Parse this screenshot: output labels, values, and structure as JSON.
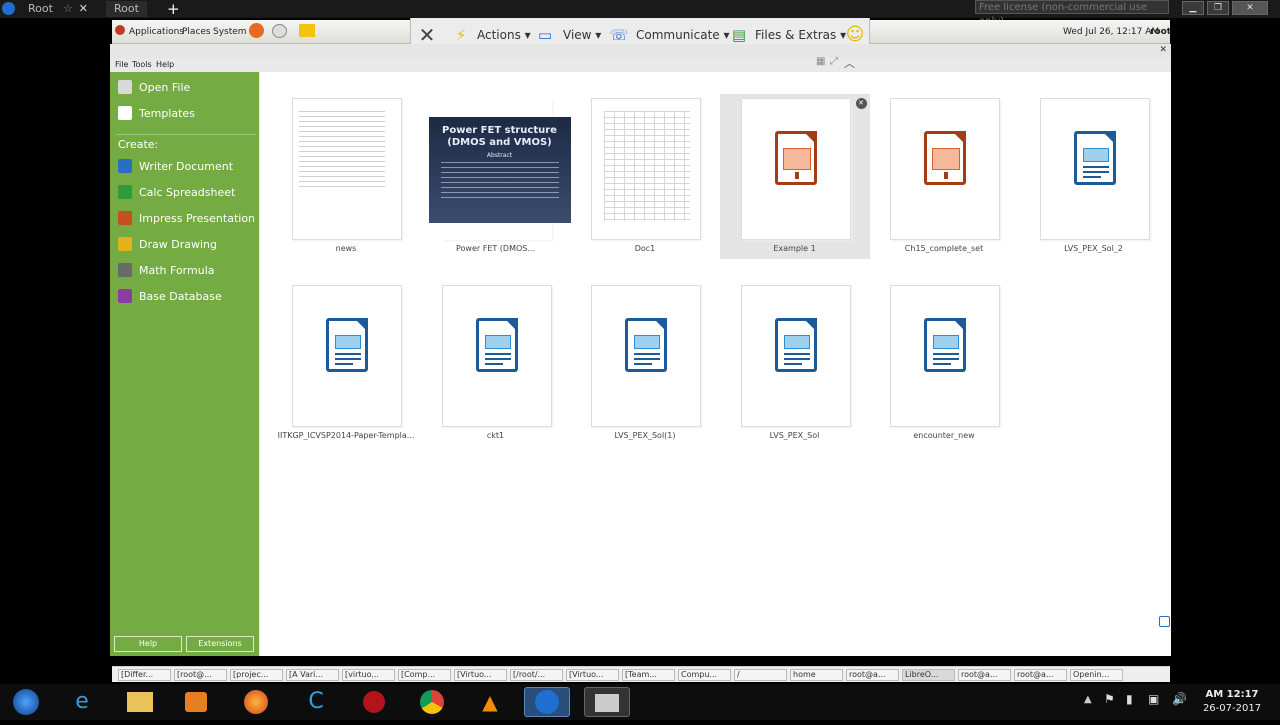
{
  "topbar": {
    "tabs": [
      {
        "label": "Root"
      },
      {
        "label": "Root"
      }
    ],
    "license": "Free license (non-commercial use only)"
  },
  "gnome_panel": {
    "applications": "Applications",
    "places": "Places",
    "system": "System",
    "datetime": "Wed Jul 26, 12:17 AM",
    "user": "root"
  },
  "tv_toolbar": {
    "actions": "Actions",
    "view": "View",
    "communicate": "Communicate",
    "files": "Files & Extras"
  },
  "lo_menu": {
    "file": "File",
    "tools": "Tools",
    "help": "Help"
  },
  "sidebar": {
    "open_file": "Open File",
    "templates": "Templates",
    "create_label": "Create:",
    "items": [
      {
        "label": "Writer Document",
        "color": "#2a6fbf"
      },
      {
        "label": "Calc Spreadsheet",
        "color": "#2f9b3a"
      },
      {
        "label": "Impress Presentation",
        "color": "#c4501d"
      },
      {
        "label": "Draw Drawing",
        "color": "#e3b21a"
      },
      {
        "label": "Math Formula",
        "color": "#6a6a6a"
      },
      {
        "label": "Base Database",
        "color": "#8b3c9e"
      }
    ],
    "help_btn": "Help",
    "extensions_btn": "Extensions"
  },
  "recent_docs": [
    {
      "label": "news",
      "type": "text"
    },
    {
      "label": "Power FET (DMOS...",
      "type": "slide"
    },
    {
      "label": "Doc1",
      "type": "table"
    },
    {
      "label": "Example 1",
      "type": "impress"
    },
    {
      "label": "Ch15_complete_set",
      "type": "impress"
    },
    {
      "label": "LVS_PEX_Sol_2",
      "type": "writer"
    },
    {
      "label": "IITKGP_ICVSP2014-Paper-Templa...",
      "type": "writer"
    },
    {
      "label": "ckt1",
      "type": "writer"
    },
    {
      "label": "LVS_PEX_Sol(1)",
      "type": "writer"
    },
    {
      "label": "LVS_PEX_Sol",
      "type": "writer"
    },
    {
      "label": "encounter_new",
      "type": "writer"
    }
  ],
  "slide_thumb": {
    "title": "Power FET structure (DMOS and VMOS)",
    "abstract": "Abstract"
  },
  "tasklist": [
    "[Differ...",
    "[root@...",
    "[projec...",
    "[A Vari...",
    "[virtuo...",
    "[Comp...",
    "[Virtuo...",
    "[/root/...",
    "[Virtuo...",
    "[Team...",
    "Compu...",
    "/",
    "home",
    "root@a...",
    "LibreO...",
    "root@a...",
    "root@a...",
    "Openin..."
  ],
  "clock": {
    "time": "AM 12:17",
    "date": "26-07-2017"
  }
}
